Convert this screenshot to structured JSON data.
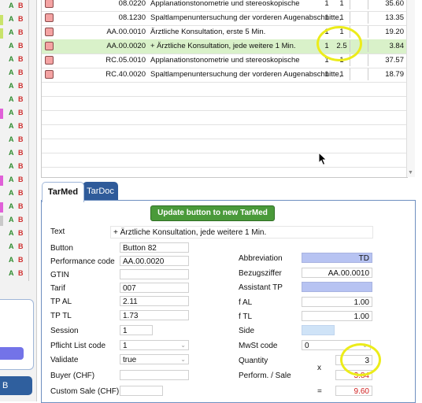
{
  "left_strip": {
    "rows": [
      {
        "a": "A",
        "b": "B",
        "bar": ""
      },
      {
        "a": "A",
        "b": "B",
        "bar": "#c9e36a"
      },
      {
        "a": "A",
        "b": "B",
        "bar": "#c9e36a"
      },
      {
        "a": "A",
        "b": "B",
        "bar": ""
      },
      {
        "a": "A",
        "b": "B",
        "bar": ""
      },
      {
        "a": "A",
        "b": "B",
        "bar": ""
      },
      {
        "a": "A",
        "b": "B",
        "bar": ""
      },
      {
        "a": "A",
        "b": "B",
        "bar": ""
      },
      {
        "a": "A",
        "b": "B",
        "bar": "#e060d8"
      },
      {
        "a": "A",
        "b": "B",
        "bar": ""
      },
      {
        "a": "A",
        "b": "B",
        "bar": ""
      },
      {
        "a": "A",
        "b": "B",
        "bar": ""
      },
      {
        "a": "A",
        "b": "B",
        "bar": ""
      },
      {
        "a": "A",
        "b": "B",
        "bar": "#e060d8"
      },
      {
        "a": "A",
        "b": "B",
        "bar": ""
      },
      {
        "a": "A",
        "b": "B",
        "bar": "#e060d8"
      },
      {
        "a": "A",
        "b": "B",
        "bar": "#c9c9c9"
      },
      {
        "a": "A",
        "b": "B",
        "bar": ""
      },
      {
        "a": "A",
        "b": "B",
        "bar": ""
      },
      {
        "a": "A",
        "b": "B",
        "bar": ""
      },
      {
        "a": "A",
        "b": "B",
        "bar": ""
      }
    ],
    "bottom_button": "B"
  },
  "table": {
    "rows": [
      {
        "code": "08.0220",
        "desc": "Applanationstonometrie und stereoskopische",
        "n1": "1",
        "n2": "1",
        "amt": "35.60",
        "selected": false
      },
      {
        "code": "08.1230",
        "desc": "Spaltlampenuntersuchung der vorderen Augenabschnitte,",
        "n1": "1",
        "n2": "1",
        "amt": "13.35",
        "selected": false
      },
      {
        "code": "AA.00.0010",
        "desc": "Ärztliche Konsultation, erste 5 Min.",
        "n1": "1",
        "n2": "1",
        "amt": "19.20",
        "selected": false
      },
      {
        "code": "AA.00.0020",
        "desc": "+ Ärztliche Konsultation, jede weitere 1 Min.",
        "n1": "1",
        "n2": "2.5",
        "amt": "3.84",
        "selected": true
      },
      {
        "code": "RC.05.0010",
        "desc": "Applanationstonometrie und stereoskopische",
        "n1": "1",
        "n2": "1",
        "amt": "37.57",
        "selected": false
      },
      {
        "code": "RC.40.0020",
        "desc": "Spaltlampenuntersuchung der vorderen Augenabschnitte,",
        "n1": "1",
        "n2": "1",
        "amt": "18.79",
        "selected": false
      }
    ]
  },
  "tabs": {
    "tarmed": "TarMed",
    "tardoc": "TarDoc"
  },
  "form": {
    "update_button": "Update button to new TarMed",
    "text_label": "Text",
    "text_value": "+ Ärztliche Konsultation, jede weitere 1 Min.",
    "button_label": "Button",
    "button_value": "Button 82",
    "perf_code_label": "Performance code",
    "perf_code_value": "AA.00.0020",
    "gtin_label": "GTIN",
    "gtin_value": "",
    "tarif_label": "Tarif",
    "tarif_value": "007",
    "tp_al_label": "TP AL",
    "tp_al_value": "2.11",
    "tp_tl_label": "TP TL",
    "tp_tl_value": "1.73",
    "session_label": "Session",
    "session_value": "1",
    "pflicht_label": "Pflicht List code",
    "pflicht_value": "1",
    "validate_label": "Validate",
    "validate_value": "true",
    "buyer_label": "Buyer (CHF)",
    "buyer_value": "",
    "custom_sale_label": "Custom Sale (CHF)",
    "custom_sale_value": "",
    "abbrev_label": "Abbreviation",
    "abbrev_value": "TD",
    "bezug_label": "Bezugsziffer",
    "bezug_value": "AA.00.0010",
    "assistant_label": "Assistant TP",
    "assistant_value": "",
    "f_al_label": "f AL",
    "f_al_value": "1.00",
    "f_tl_label": "f TL",
    "f_tl_value": "1.00",
    "side_label": "Side",
    "side_value": "",
    "mwst_label": "MwSt code",
    "mwst_value": "0",
    "quantity_label": "Quantity",
    "quantity_value": "3",
    "perform_sale_label": "Perform. / Sale",
    "perform_sale_value": "3.84",
    "x_sign": "x",
    "eq_sign": "=",
    "total_value": "9.60"
  },
  "colors": {
    "selected_row": "#d9f1c9",
    "update_button": "#4a9a3a",
    "tab_active_bg": "#ffffff",
    "tab_inactive_bg": "#2f5b9a",
    "highlight_circle": "#ecec1a",
    "total_red": "#d02020"
  }
}
